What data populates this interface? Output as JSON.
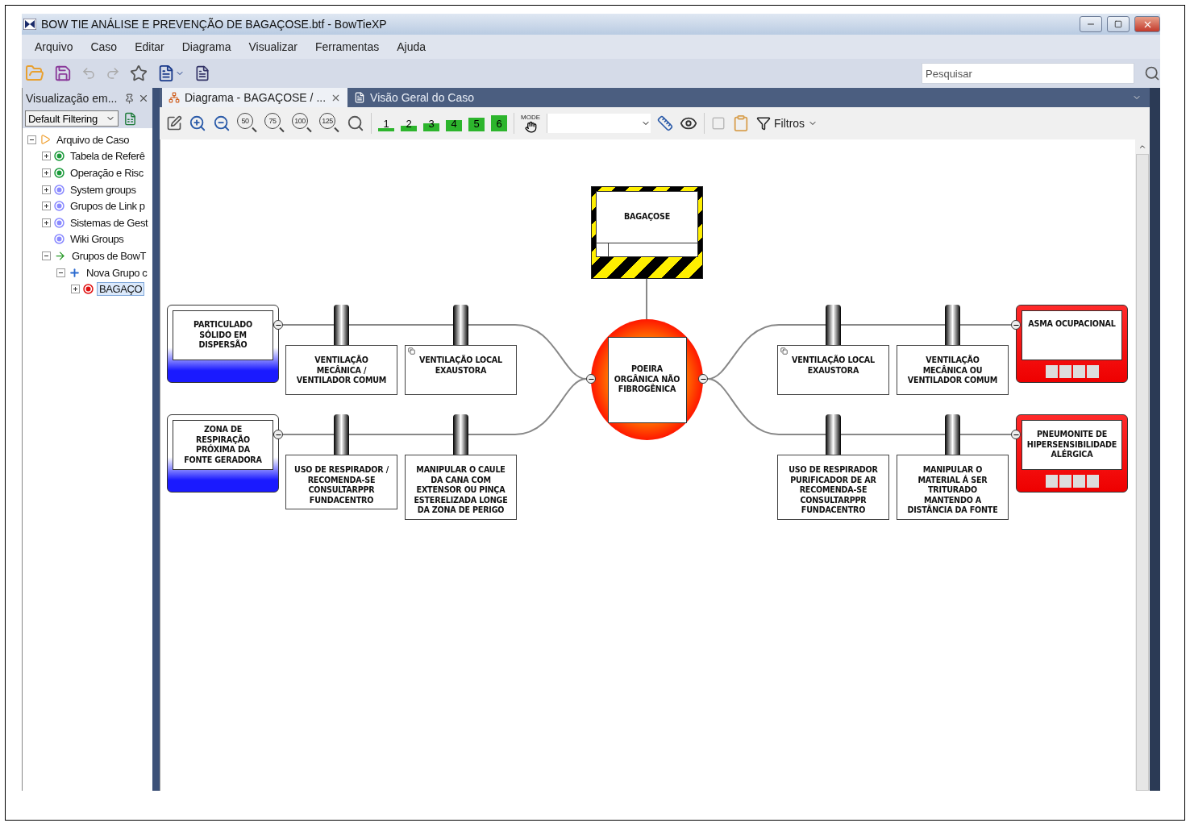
{
  "window": {
    "title": "BOW TIE ANÁLISE E PREVENÇÃO DE BAGAÇOSE.btf - BowTieXP"
  },
  "menu": [
    "Arquivo",
    "Caso",
    "Editar",
    "Diagrama",
    "Visualizar",
    "Ferramentas",
    "Ajuda"
  ],
  "search": {
    "placeholder": "Pesquisar"
  },
  "panel": {
    "title": "Visualização em...",
    "filter": "Default Filtering",
    "tree": [
      {
        "label": "Arquivo de Caso",
        "kind": "case",
        "expandable": true,
        "expanded": true,
        "selected": false,
        "children": [
          {
            "label": "Tabela de Referê",
            "kind": "green",
            "expandable": true,
            "expanded": false,
            "selected": false
          },
          {
            "label": "Operação e Risc",
            "kind": "green",
            "expandable": true,
            "expanded": false,
            "selected": false
          },
          {
            "label": "System groups",
            "kind": "blue",
            "expandable": true,
            "expanded": false,
            "selected": false
          },
          {
            "label": "Grupos de Link p",
            "kind": "blue",
            "expandable": true,
            "expanded": false,
            "selected": false
          },
          {
            "label": "Sistemas de Gest",
            "kind": "blue",
            "expandable": true,
            "expanded": false,
            "selected": false
          },
          {
            "label": "Wiki Groups",
            "kind": "blue",
            "expandable": false,
            "selected": false
          },
          {
            "label": "Grupos de BowT",
            "kind": "arrow",
            "expandable": true,
            "expanded": true,
            "selected": false,
            "children": [
              {
                "label": "Nova Grupo c",
                "kind": "plus",
                "expandable": true,
                "expanded": true,
                "selected": false,
                "children": [
                  {
                    "label": "BAGAÇO",
                    "kind": "red",
                    "expandable": true,
                    "expanded": false,
                    "selected": true
                  }
                ]
              }
            ]
          }
        ]
      }
    ]
  },
  "tabs": [
    {
      "label": "Diagrama -  BAGAÇOSE / ...",
      "kind": "diagram",
      "selected": true
    },
    {
      "label": "Visão Geral do Caso",
      "kind": "document",
      "selected": false
    }
  ],
  "diagram_toolbar": {
    "zooms": [
      "50",
      "75",
      "100",
      "125"
    ],
    "levels": [
      "1",
      "2",
      "3",
      "4",
      "5",
      "6"
    ],
    "mode": "MODE",
    "filters": "Filtros"
  },
  "diagram": {
    "hazard": "BAGAÇOSE",
    "top_event": "POEIRA ORGÂNICA NÃO FIBROGÊNICA",
    "threats": [
      {
        "label": "PARTICULADO SÓLIDO EM DISPERSÃO",
        "barriers": [
          {
            "label": "VENTILAÇÃO MECÂNICA / VENTILADOR COMUM",
            "linked": false
          },
          {
            "label": "VENTILAÇÃO LOCAL EXAUSTORA",
            "linked": true
          }
        ]
      },
      {
        "label": "ZONA DE RESPIRAÇÃO PRÓXIMA DA FONTE GERADORA",
        "barriers": [
          {
            "label": "USO DE RESPIRADOR / RECOMENDA-SE CONSULTARPPR FUNDACENTRO",
            "linked": false
          },
          {
            "label": "MANIPULAR O CAULE DA CANA COM EXTENSOR OU PINÇA ESTERELIZADA LONGE DA ZONA DE PERIGO",
            "linked": false
          }
        ]
      }
    ],
    "consequences": [
      {
        "label": "ASMA OCUPACIONAL",
        "barriers": [
          {
            "label": "VENTILAÇÃO LOCAL EXAUSTORA",
            "linked": true
          },
          {
            "label": "VENTILAÇÃO MECÂNICA OU VENTILADOR COMUM",
            "linked": false
          }
        ]
      },
      {
        "label": "PNEUMONITE DE HIPERSENSIBILIDADE ALÉRGICA",
        "barriers": [
          {
            "label": "USO DE RESPIRADOR PURIFICADOR DE AR RECOMENDA-SE CONSULTARPPR FUNDACENTRO",
            "linked": false
          },
          {
            "label": "MANIPULAR O MATERIAL Á SER TRITURADO MANTENDO A DISTÂNCIA DA FONTE",
            "linked": false
          }
        ]
      }
    ]
  }
}
